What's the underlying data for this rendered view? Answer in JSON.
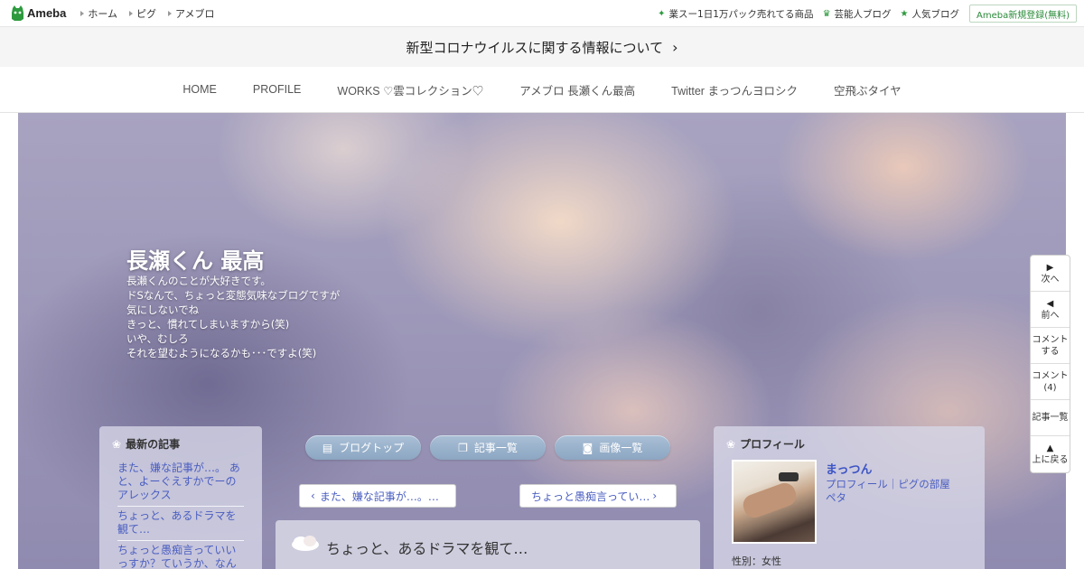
{
  "topbar": {
    "logo": "Ameba",
    "nav": [
      "ホーム",
      "ピグ",
      "アメブロ"
    ],
    "links": [
      {
        "icon": "sparkle-icon",
        "label": "業スー1日1万パック売れてる商品"
      },
      {
        "icon": "crown-icon",
        "label": "芸能人ブログ"
      },
      {
        "icon": "star-icon",
        "label": "人気ブログ"
      }
    ],
    "register": "Ameba新規登録(無料)"
  },
  "notice": {
    "text": "新型コロナウイルスに関する情報について"
  },
  "mainnav": [
    "HOME",
    "PROFILE",
    "WORKS ♡雲コレクション♡",
    "アメブロ 長瀬くん最高",
    "Twitter まっつんヨロシク",
    "空飛ぶタイヤ"
  ],
  "blog": {
    "title": "長瀬くん 最高",
    "description": [
      "長瀬くんのことが大好きです。",
      "ドSなんで、ちょっと変態気味なブログですが",
      "気にしないでね",
      "きっと、慣れてしまいますから(笑)",
      "いや、むしろ",
      "それを望むようになるかも･･･ですよ(笑)"
    ]
  },
  "recent": {
    "heading": "最新の記事",
    "items": [
      "また、嫌な記事が…。 あと、よーぐえすかでーのアレックス",
      "ちょっと、あるドラマを観て…",
      "ちょっと愚痴言っていいっすか？ていうか、なん"
    ]
  },
  "tabs": [
    {
      "icon": "document-icon",
      "label": "ブログトップ"
    },
    {
      "icon": "copy-icon",
      "label": "記事一覧"
    },
    {
      "icon": "camera-icon",
      "label": "画像一覧"
    }
  ],
  "pager": {
    "prev": "また、嫌な記事が…。…",
    "next": "ちょっと愚痴言ってい…"
  },
  "article": {
    "title": "ちょっと、あるドラマを観て…"
  },
  "profile": {
    "heading": "プロフィール",
    "name": "まっつん",
    "links": "プロフィール｜ピグの部屋",
    "links2": "ペタ",
    "gender": "性別：女性"
  },
  "sidenav": [
    {
      "icon": "play-right-icon",
      "label": "次へ"
    },
    {
      "icon": "play-left-icon",
      "label": "前へ"
    },
    {
      "icon": "",
      "label": "コメント\nする"
    },
    {
      "icon": "",
      "label": "コメント\n(4)"
    },
    {
      "icon": "",
      "label": "記事一覧"
    },
    {
      "icon": "up-triangle-icon",
      "label": "上に戻る"
    }
  ],
  "colors": {
    "accent_green": "#2d9a3e",
    "link_blue": "#4a5ec0",
    "tab_blue": "#8ca6c2"
  }
}
